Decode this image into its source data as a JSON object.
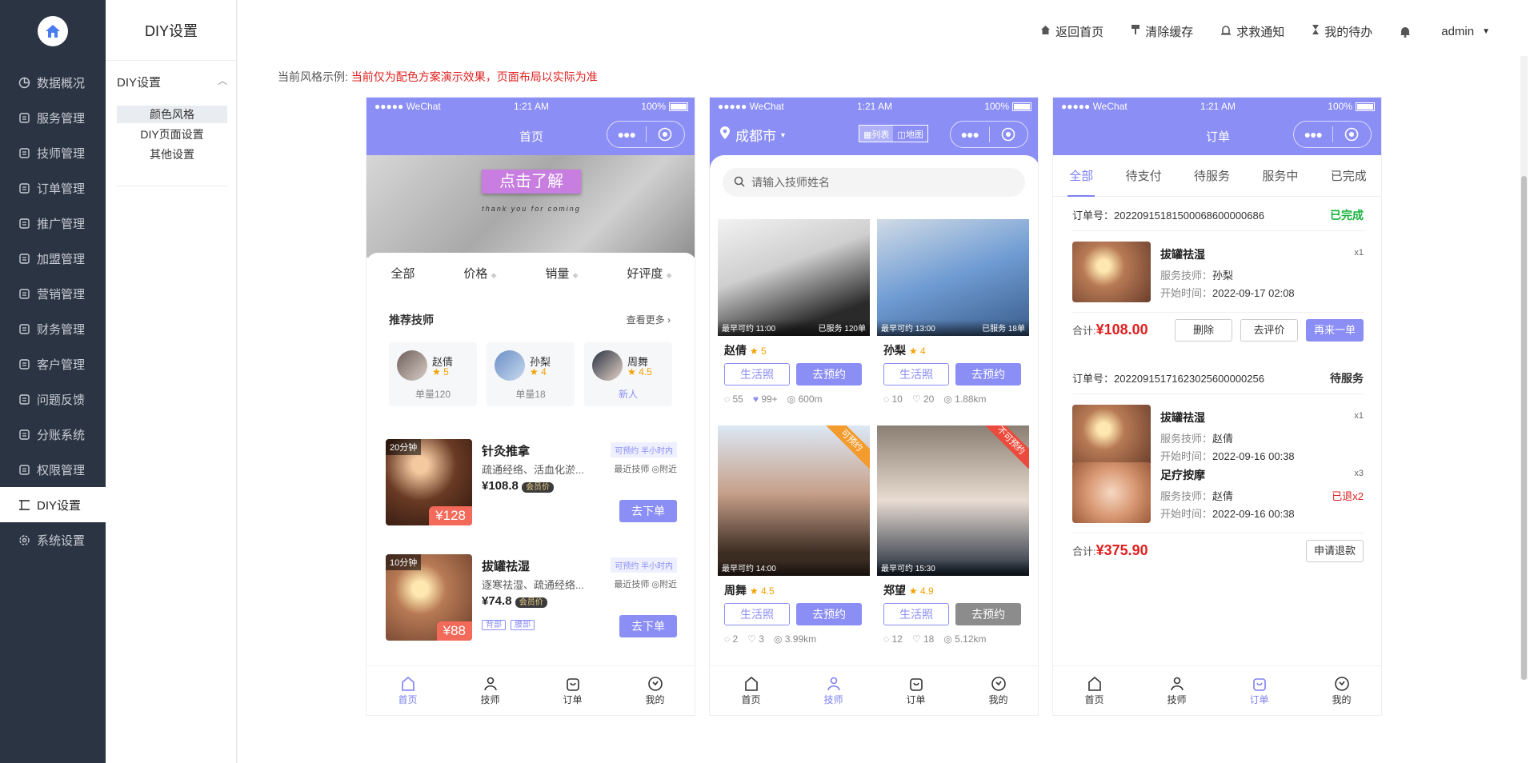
{
  "sidebar": {
    "items": [
      {
        "label": "数据概况",
        "icon": "chart-pie-icon",
        "active": false
      },
      {
        "label": "服务管理",
        "icon": "calendar-icon",
        "active": false
      },
      {
        "label": "技师管理",
        "icon": "headset-icon",
        "active": false
      },
      {
        "label": "订单管理",
        "icon": "clipboard-icon",
        "active": false
      },
      {
        "label": "推广管理",
        "icon": "share-network-icon",
        "active": false
      },
      {
        "label": "加盟管理",
        "icon": "user-plus-icon",
        "active": false
      },
      {
        "label": "营销管理",
        "icon": "ticket-icon",
        "active": false
      },
      {
        "label": "财务管理",
        "icon": "wallet-icon",
        "active": false
      },
      {
        "label": "客户管理",
        "icon": "users-icon",
        "active": false
      },
      {
        "label": "问题反馈",
        "icon": "edit-icon",
        "active": false
      },
      {
        "label": "分账系统",
        "icon": "bar-chart-icon",
        "active": false
      },
      {
        "label": "权限管理",
        "icon": "lock-icon",
        "active": false
      },
      {
        "label": "DIY设置",
        "icon": "layout-icon",
        "active": true
      },
      {
        "label": "系统设置",
        "icon": "gear-icon",
        "active": false
      }
    ]
  },
  "subnav": {
    "title": "DIY设置",
    "group": "DIY设置",
    "items": [
      "颜色风格",
      "DIY页面设置",
      "其他设置"
    ]
  },
  "topbar": {
    "home": "返回首页",
    "clear": "清除缓存",
    "help": "求救通知",
    "todo": "我的待办",
    "user": "admin"
  },
  "notice": {
    "label": "当前风格示例:",
    "text": "当前仅为配色方案演示效果，页面布局以实际为准"
  },
  "theme": {
    "primary": "#8b8ef4",
    "price": "#e02020",
    "star": "#f4a100",
    "done": "#17b33c"
  },
  "status": {
    "carrier": "●●●●● WeChat",
    "time": "1:21 AM",
    "battery": "100%"
  },
  "tabbar": [
    "首页",
    "技师",
    "订单",
    "我的"
  ],
  "home": {
    "title": "首页",
    "banner": "点击了解",
    "banner_sub": "thank you for coming",
    "filters": [
      "全部",
      "价格",
      "销量",
      "好评度"
    ],
    "rec_title": "推荐技师",
    "rec_more": "查看更多",
    "techs": [
      {
        "name": "赵倩",
        "rating": "5",
        "sub": "单量120"
      },
      {
        "name": "孙梨",
        "rating": "4",
        "sub": "单量18"
      },
      {
        "name": "周舞",
        "rating": "4.5",
        "sub": "新人"
      }
    ],
    "services": [
      {
        "duration": "20分钟",
        "name": "针灸推拿",
        "tag": "可预约 半小时内",
        "desc": "疏通经络、活血化淤...",
        "price": "¥108.8",
        "member": "会员价",
        "orig": "¥128",
        "near1": "最近技师",
        "near2": "附近",
        "order": "去下单",
        "chips": []
      },
      {
        "duration": "10分钟",
        "name": "拔罐祛湿",
        "tag": "可预约 半小时内",
        "desc": "逐寒祛湿、疏通经络...",
        "price": "¥74.8",
        "member": "会员价",
        "orig": "¥88",
        "near1": "最近技师",
        "near2": "附近",
        "order": "去下单",
        "chips": [
          "背部",
          "腰部"
        ]
      }
    ]
  },
  "tech": {
    "city": "成都市",
    "list_label": "列表",
    "map_label": "地图",
    "search_placeholder": "请输入技师姓名",
    "cards": [
      {
        "name": "赵倩",
        "rating": "5",
        "time": "最早可约 11:00",
        "served": "已服务 120单",
        "comments": "55",
        "likes": "99+",
        "dist": "600m",
        "badge": "",
        "life": "生活照",
        "book": "去预约",
        "bookable": true
      },
      {
        "name": "孙梨",
        "rating": "4",
        "time": "最早可约 13:00",
        "served": "已服务 18单",
        "comments": "10",
        "likes": "20",
        "dist": "1.88km",
        "badge": "",
        "life": "生活照",
        "book": "去预约",
        "bookable": true
      },
      {
        "name": "周舞",
        "rating": "4.5",
        "time": "最早可约 14:00",
        "served": "",
        "comments": "2",
        "likes": "3",
        "dist": "3.99km",
        "badge": "可预约",
        "life": "生活照",
        "book": "去预约",
        "bookable": true
      },
      {
        "name": "郑望",
        "rating": "4.9",
        "time": "最早可约 15:30",
        "served": "",
        "comments": "12",
        "likes": "18",
        "dist": "5.12km",
        "badge": "不可预约",
        "life": "生活照",
        "book": "去预约",
        "bookable": false
      }
    ]
  },
  "orders": {
    "title": "订单",
    "tabs": [
      "全部",
      "待支付",
      "待服务",
      "服务中",
      "已完成"
    ],
    "list": [
      {
        "no": "订单号：2022091518150006860000068​6",
        "status": "已完成",
        "items": [
          {
            "name": "拔罐祛湿",
            "qty": "x1",
            "tech_label": "服务技师：",
            "tech": "孙梨",
            "time_label": "开始时间：",
            "time": "2022-09-17 02:08",
            "refund": ""
          }
        ],
        "total_label": "合计:",
        "total": "¥108.00",
        "actions": [
          "删除",
          "去评价",
          "再来一单"
        ]
      },
      {
        "no": "订单号：2022091517162302560000025​6",
        "status": "待服务",
        "items": [
          {
            "name": "拔罐祛湿",
            "qty": "x1",
            "tech_label": "服务技师：",
            "tech": "赵倩",
            "time_label": "开始时间：",
            "time": "2022-09-16 00:38",
            "refund": ""
          },
          {
            "name": "足疗按摩",
            "qty": "x3",
            "tech_label": "服务技师：",
            "tech": "赵倩",
            "time_label": "开始时间：",
            "time": "2022-09-16 00:38",
            "refund": "已退x2"
          }
        ],
        "total_label": "合计:",
        "total": "¥375.90",
        "actions": [
          "申请退款"
        ]
      }
    ]
  }
}
